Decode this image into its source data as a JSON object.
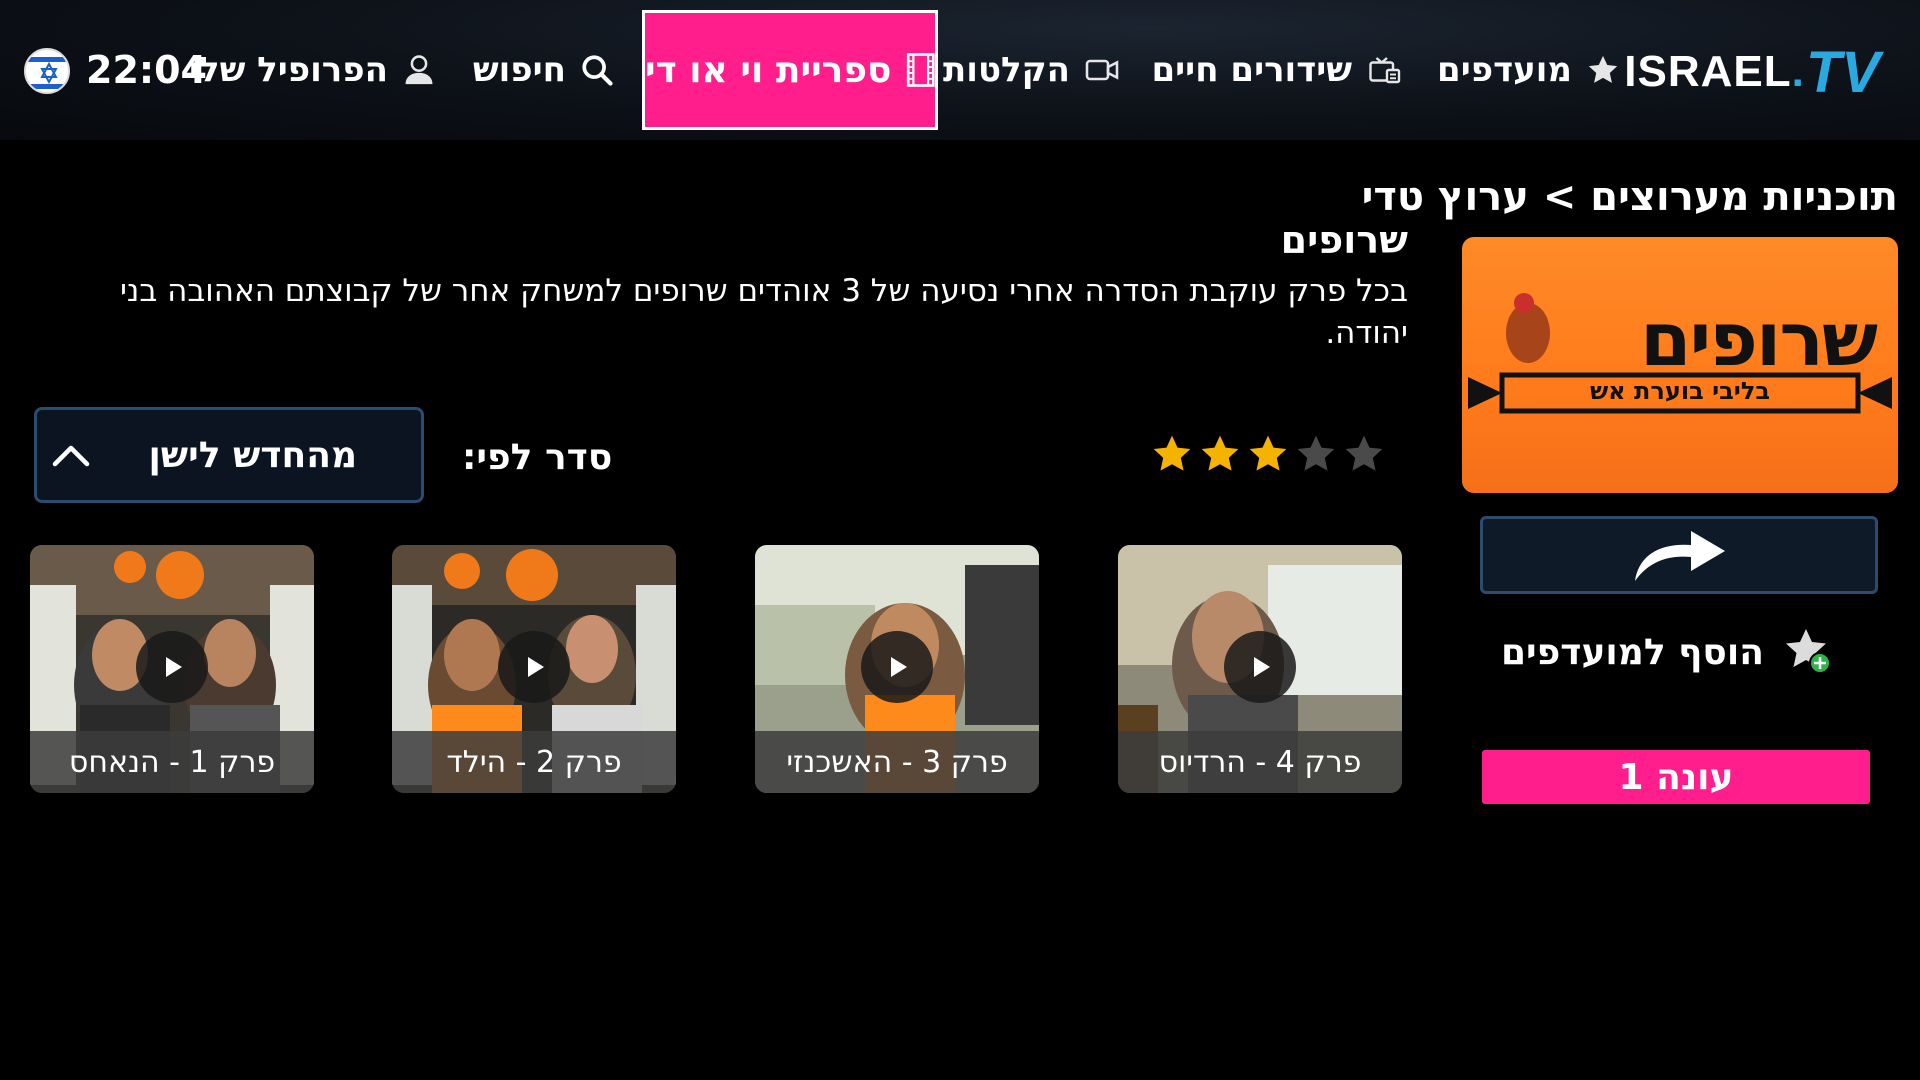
{
  "nav": {
    "logo_main": "ISRAEL",
    "logo_dot": ".",
    "logo_tv": "TV",
    "favorites": "מועדפים",
    "live": "שידורים חיים",
    "recordings": "הקלטות",
    "vod": "ספריית וי או די",
    "search": "חיפוש",
    "profile": "הפרופיל שלי",
    "clock": "22:04"
  },
  "page": {
    "breadcrumb": "תוכניות מערוצים > ערוץ טדי",
    "show_title": "שרופים",
    "description": "בכל פרק עוקבת הסדרה אחרי נסיעה של 3 אוהדים שרופים למשחק אחר של קבוצתם האהובה בני יהודה."
  },
  "poster": {
    "title_art": "שרופים",
    "subtitle_art": "בליבי בוערת אש"
  },
  "rating": {
    "value": 3,
    "max": 5,
    "active_color": "#f5b301",
    "inactive_color": "#4a4a4a"
  },
  "actions": {
    "share_icon": "share-arrow-icon",
    "add_favorites": "הוסף למועדפים",
    "season": "עונה 1"
  },
  "sort": {
    "label": "סדר לפי:",
    "value": "מהחדש לישן"
  },
  "episodes": [
    {
      "title": "פרק 4 - הרדיוס"
    },
    {
      "title": "פרק 3 - האשכנזי"
    },
    {
      "title": "פרק 2 - הילד"
    },
    {
      "title": "פרק 1 - הנאחס"
    }
  ],
  "colors": {
    "accent_pink": "#ff1e8c",
    "logo_blue": "#2aa9e0",
    "border_blue": "#2c4c6e"
  }
}
